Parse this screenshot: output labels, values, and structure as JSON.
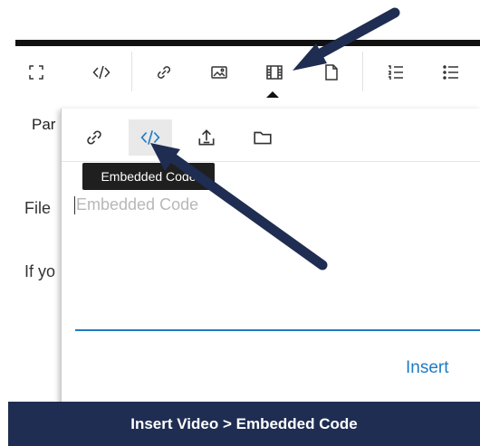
{
  "toolbar": {
    "buttons": [
      {
        "name": "fullscreen-icon"
      },
      {
        "name": "code-view-icon"
      },
      {
        "name": "link-icon"
      },
      {
        "name": "image-icon"
      },
      {
        "name": "video-icon"
      },
      {
        "name": "file-icon"
      },
      {
        "name": "ordered-list-icon"
      },
      {
        "name": "unordered-list-icon"
      }
    ]
  },
  "editor": {
    "paragraph_label": "Par",
    "line1": "File",
    "line2": "If yo"
  },
  "video_popup": {
    "tabs": [
      {
        "name": "link-icon",
        "active": false
      },
      {
        "name": "embedded-code-icon",
        "active": true
      },
      {
        "name": "upload-icon",
        "active": false
      },
      {
        "name": "folder-icon",
        "active": false
      }
    ],
    "tooltip": "Embedded Code",
    "placeholder": "Embedded Code",
    "insert_label": "Insert"
  },
  "banner": {
    "text": "Insert Video > Embedded Code"
  },
  "colors": {
    "accent": "#1e7bc4",
    "banner_bg": "#1f2d52",
    "arrow": "#1f2d52",
    "tooltip_bg": "#1f1f1f"
  }
}
